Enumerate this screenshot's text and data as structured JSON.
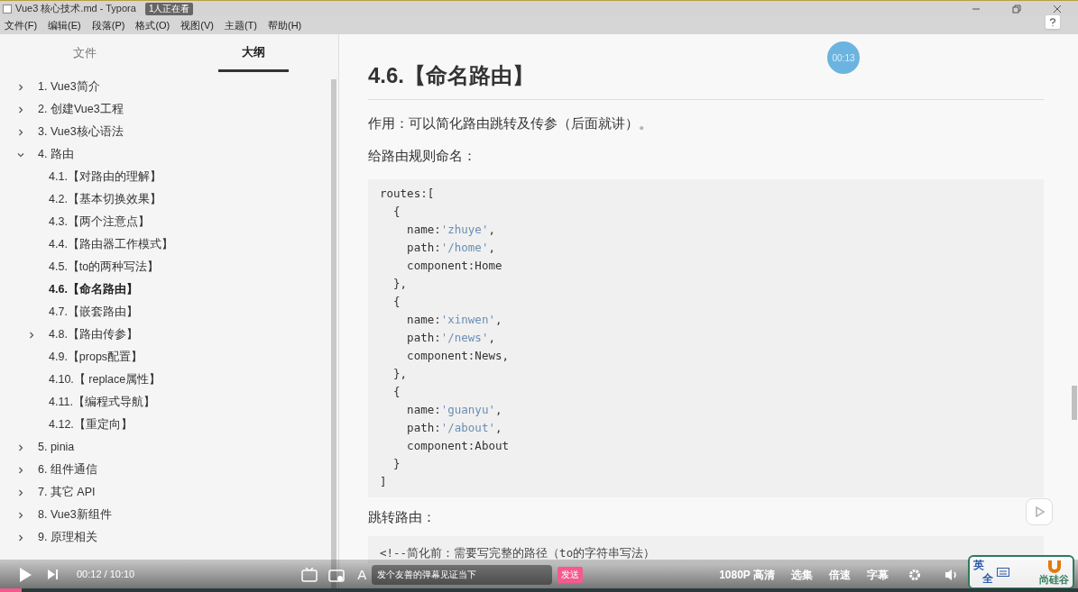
{
  "window": {
    "title": "Vue3 核心技术.md - Typora"
  },
  "menu": [
    "文件(F)",
    "编辑(E)",
    "段落(P)",
    "格式(O)",
    "视图(V)",
    "主题(T)",
    "帮助(H)"
  ],
  "viewers": "1人正在看",
  "sidebar": {
    "tabs": [
      {
        "label": "文件",
        "selected": false
      },
      {
        "label": "大纲",
        "selected": true
      }
    ],
    "outline": [
      {
        "label": "1. Vue3简介",
        "expanded": false,
        "selected": false
      },
      {
        "label": "2. 创建Vue3工程",
        "expanded": false,
        "selected": false
      },
      {
        "label": "3. Vue3核心语法",
        "expanded": false,
        "selected": false
      },
      {
        "label": "4. 路由",
        "expanded": true,
        "selected": false,
        "children": [
          {
            "label": "4.1.【对路由的理解】",
            "selected": false
          },
          {
            "label": "4.2.【基本切换效果】",
            "selected": false
          },
          {
            "label": "4.3.【两个注意点】",
            "selected": false
          },
          {
            "label": "4.4.【路由器工作模式】",
            "selected": false
          },
          {
            "label": "4.5.【to的两种写法】",
            "selected": false
          },
          {
            "label": "4.6.【命名路由】",
            "selected": true
          },
          {
            "label": "4.7.【嵌套路由】",
            "selected": false
          },
          {
            "label": "4.8.【路由传参】",
            "expanded": false,
            "selected": false
          },
          {
            "label": "4.9.【props配置】",
            "selected": false
          },
          {
            "label": "4.10.【 replace属性】",
            "selected": false
          },
          {
            "label": "4.11.【编程式导航】",
            "selected": false
          },
          {
            "label": "4.12.【重定向】",
            "selected": false
          }
        ]
      },
      {
        "label": "5. pinia",
        "expanded": false,
        "selected": false
      },
      {
        "label": "6. 组件通信",
        "expanded": false,
        "selected": false
      },
      {
        "label": "7. 其它 API",
        "expanded": false,
        "selected": false
      },
      {
        "label": "8. Vue3新组件",
        "expanded": false,
        "selected": false
      },
      {
        "label": "9. 原理相关",
        "expanded": false,
        "selected": false
      }
    ]
  },
  "timer_badge": "00:13",
  "document": {
    "heading": "4.6.【命名路由】",
    "paragraph_1": "作用：可以简化路由跳转及传参（后面就讲）。",
    "paragraph_2": "给路由规则命名：",
    "code": [
      [
        {
          "kind": "plain",
          "text": "routes:["
        }
      ],
      [
        {
          "kind": "plain",
          "text": "  {"
        }
      ],
      [
        {
          "kind": "plain",
          "text": "    name:"
        },
        {
          "kind": "string",
          "text": "'zhuye'"
        },
        {
          "kind": "plain",
          "text": ","
        }
      ],
      [
        {
          "kind": "plain",
          "text": "    path:"
        },
        {
          "kind": "string",
          "text": "'/home'"
        },
        {
          "kind": "plain",
          "text": ","
        }
      ],
      [
        {
          "kind": "plain",
          "text": "    component:Home"
        }
      ],
      [
        {
          "kind": "plain",
          "text": "  },"
        }
      ],
      [
        {
          "kind": "plain",
          "text": "  {"
        }
      ],
      [
        {
          "kind": "plain",
          "text": "    name:"
        },
        {
          "kind": "string",
          "text": "'xinwen'"
        },
        {
          "kind": "plain",
          "text": ","
        }
      ],
      [
        {
          "kind": "plain",
          "text": "    path:"
        },
        {
          "kind": "string",
          "text": "'/news'"
        },
        {
          "kind": "plain",
          "text": ","
        }
      ],
      [
        {
          "kind": "plain",
          "text": "    component:News,"
        }
      ],
      [
        {
          "kind": "plain",
          "text": "  },"
        }
      ],
      [
        {
          "kind": "plain",
          "text": "  {"
        }
      ],
      [
        {
          "kind": "plain",
          "text": "    name:"
        },
        {
          "kind": "string",
          "text": "'guanyu'"
        },
        {
          "kind": "plain",
          "text": ","
        }
      ],
      [
        {
          "kind": "plain",
          "text": "    path:"
        },
        {
          "kind": "string",
          "text": "'/about'"
        },
        {
          "kind": "plain",
          "text": ","
        }
      ],
      [
        {
          "kind": "plain",
          "text": "    component:About"
        }
      ],
      [
        {
          "kind": "plain",
          "text": "  }"
        }
      ],
      [
        {
          "kind": "plain",
          "text": "]"
        }
      ]
    ],
    "paragraph_3": "跳转路由：",
    "code_2": "<!--简化前：需要写完整的路径（to的字符串写法）"
  },
  "player": {
    "level": 0.02,
    "style_glyph": "A",
    "time": "00:12 / 10:10",
    "danmaku_placeholder": "发个友善的弹幕见证当下",
    "send": "发送",
    "options": [
      "1080P 高清",
      "选集",
      "倍速",
      "字幕"
    ]
  },
  "ime": {
    "mode": "英",
    "width": "全"
  },
  "logo": "尚硅谷"
}
